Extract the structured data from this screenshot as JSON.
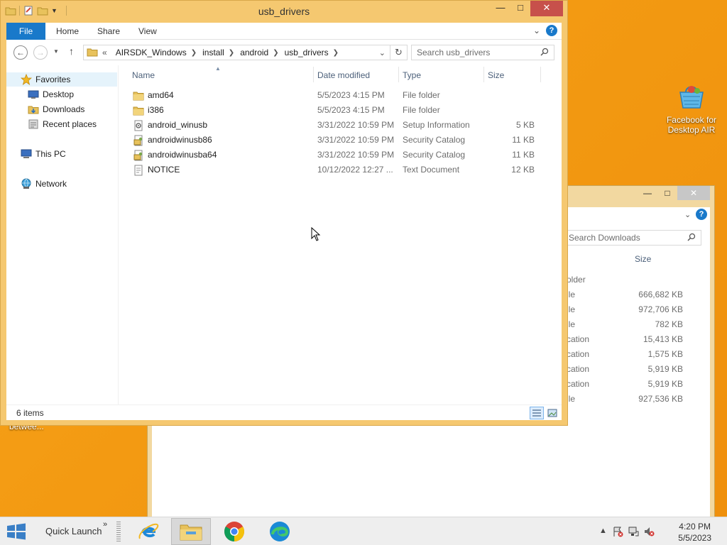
{
  "desktop": {
    "icon_label_line1": "Facebook for",
    "icon_label_line2": "Desktop AIR",
    "partial_label": "betwee..."
  },
  "bg_window": {
    "search_placeholder": "Search Downloads",
    "col_size": "Size",
    "rows": [
      {
        "type": "older",
        "size": ""
      },
      {
        "type": "ile",
        "size": "666,682 KB"
      },
      {
        "type": "ile",
        "size": "972,706 KB"
      },
      {
        "type": "ile",
        "size": "782 KB"
      },
      {
        "type": "cation",
        "size": "15,413 KB"
      },
      {
        "type": "cation",
        "size": "1,575 KB"
      },
      {
        "type": "cation",
        "size": "5,919 KB"
      },
      {
        "type": "cation",
        "size": "5,919 KB"
      },
      {
        "type": "ile",
        "size": "927,536 KB"
      }
    ]
  },
  "window": {
    "title": "usb_drivers",
    "ribbon": {
      "file": "File",
      "home": "Home",
      "share": "Share",
      "view": "View"
    },
    "breadcrumb": {
      "overflow": "«",
      "items": [
        "AIRSDK_Windows",
        "install",
        "android",
        "usb_drivers"
      ]
    },
    "search_placeholder": "Search usb_drivers",
    "nav_pane": {
      "favorites": "Favorites",
      "desktop": "Desktop",
      "downloads": "Downloads",
      "recent": "Recent places",
      "this_pc": "This PC",
      "network": "Network"
    },
    "columns": {
      "name": "Name",
      "date": "Date modified",
      "type": "Type",
      "size": "Size"
    },
    "files": [
      {
        "name": "amd64",
        "date": "5/5/2023 4:15 PM",
        "type": "File folder",
        "size": "",
        "icon": "folder-icon"
      },
      {
        "name": "i386",
        "date": "5/5/2023 4:15 PM",
        "type": "File folder",
        "size": "",
        "icon": "folder-icon"
      },
      {
        "name": "android_winusb",
        "date": "3/31/2022 10:59 PM",
        "type": "Setup Information",
        "size": "5 KB",
        "icon": "setup-file-icon"
      },
      {
        "name": "androidwinusb86",
        "date": "3/31/2022 10:59 PM",
        "type": "Security Catalog",
        "size": "11 KB",
        "icon": "catalog-file-icon"
      },
      {
        "name": "androidwinusba64",
        "date": "3/31/2022 10:59 PM",
        "type": "Security Catalog",
        "size": "11 KB",
        "icon": "catalog-file-icon"
      },
      {
        "name": "NOTICE",
        "date": "10/12/2022 12:27 ...",
        "type": "Text Document",
        "size": "12 KB",
        "icon": "text-file-icon"
      }
    ],
    "status": "6 items"
  },
  "taskbar": {
    "quick_launch": "Quick Launch",
    "quick_launch_arrow": "»",
    "time": "4:20 PM",
    "date": "5/5/2023"
  },
  "colors": {
    "accent": "#1979ca",
    "window_frame": "#f5c870",
    "desktop": "#f39a12"
  }
}
